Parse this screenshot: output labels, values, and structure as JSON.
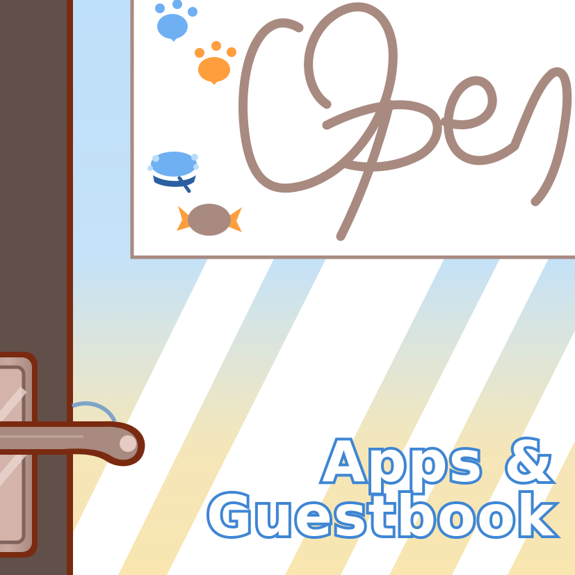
{
  "sign": {
    "text": "Open"
  },
  "title": {
    "line1": "Apps &",
    "line2": "Guestbook"
  },
  "colors": {
    "sky_top": "#bfe0fb",
    "sky_bottom": "#f9e6b0",
    "door": "#615049",
    "door_outline": "#7a2a10",
    "sign_border": "#a88a80",
    "sign_text": "#a88a80",
    "title_stroke": "#3f86d4",
    "paw_blue": "#6fb0f3",
    "paw_orange": "#ff9e3d"
  },
  "icons": [
    "paw-blue-icon",
    "paw-orange-icon",
    "macaron-icon",
    "candy-icon",
    "door-handle-icon"
  ]
}
